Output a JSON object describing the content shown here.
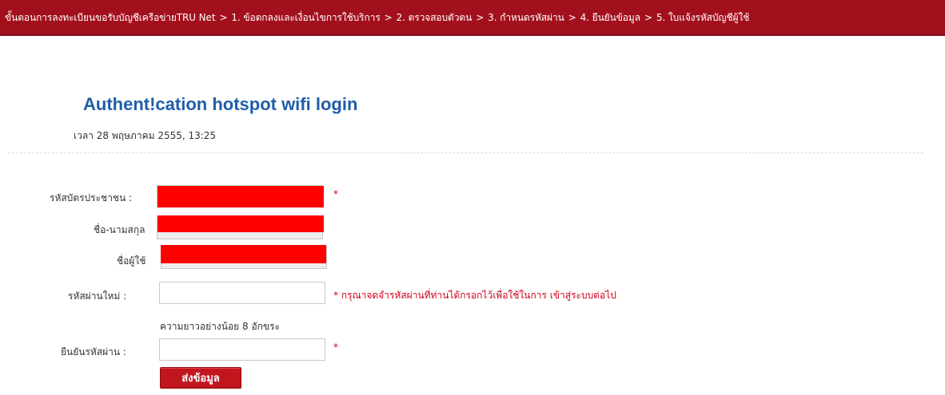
{
  "breadcrumb": {
    "prefix": "ขั้นตอนการลงทะเบียนขอรับบัญชีเครือข่ายTRU Net",
    "separator": ">",
    "steps": [
      "1. ข้อตกลงและเงื่อนไขการใช้บริการ",
      "2. ตรวจสอบตัวตน",
      "3. กำหนดรหัสผ่าน",
      "4. ยืนยันข้อมูล",
      "5. ใบแจ้งรหัสบัญชีผู้ใช้"
    ]
  },
  "header": {
    "title": "Authent!cation hotspot wifi login",
    "timestamp": "เวลา 28 พฤษภาคม 2555, 13:25"
  },
  "form": {
    "id_card": {
      "label": "รหัสบัตรประชาชน :",
      "required_mark": "*"
    },
    "fullname": {
      "label": "ชื่อ-นามสกุล"
    },
    "username": {
      "label": "ชื่อผู้ใช้"
    },
    "new_password": {
      "label": "รหัสผ่านใหม่ :",
      "required_note": "* กรุณาจดจำรหัสผ่านที่ท่านได้กรอกไว้เพื่อใช้ในการ เข้าสู่ระบบต่อไป",
      "hint": "ความยาวอย่างน้อย 8 อักขระ"
    },
    "confirm_password": {
      "label": "ยืนยันรหัสผ่าน :",
      "required_mark": "*"
    },
    "submit_label": "ส่งข้อมูล"
  },
  "colors": {
    "topbar": "#a3101d",
    "title": "#1f5ea8",
    "required": "#d0021b",
    "redaction": "#ff0000",
    "button": "#c2161f"
  }
}
